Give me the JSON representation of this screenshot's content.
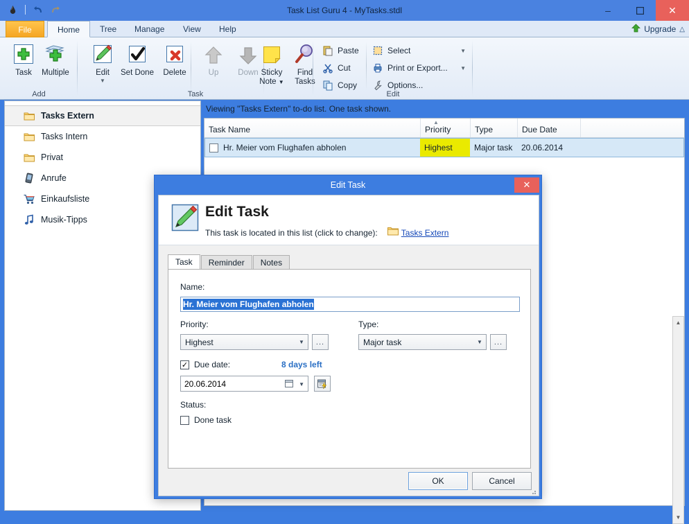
{
  "window": {
    "title": "Task List Guru 4 - MyTasks.stdl",
    "quick_access": [
      "app-icon",
      "undo-icon",
      "redo-icon"
    ],
    "buttons": {
      "minimize": "–",
      "maximize": "❐",
      "close": "✕"
    }
  },
  "ribbon": {
    "tabs": [
      {
        "label": "File",
        "active": false,
        "is_file": true
      },
      {
        "label": "Home",
        "active": true
      },
      {
        "label": "Tree",
        "active": false
      },
      {
        "label": "Manage",
        "active": false
      },
      {
        "label": "View",
        "active": false
      },
      {
        "label": "Help",
        "active": false
      }
    ],
    "upgrade_label": "Upgrade",
    "groups": [
      {
        "name": "Add",
        "buttons": [
          {
            "label": "Task",
            "icon": "add-task-icon",
            "enabled": true
          },
          {
            "label": "Multiple",
            "icon": "add-multiple-icon",
            "enabled": true
          }
        ]
      },
      {
        "name": "Task",
        "buttons": [
          {
            "label": "Edit",
            "icon": "edit-pencil-icon",
            "enabled": true,
            "has_dropdown": true
          },
          {
            "label": "Set Done",
            "icon": "checkmark-icon",
            "enabled": true
          },
          {
            "label": "Delete",
            "icon": "delete-x-icon",
            "enabled": true
          },
          {
            "label": "Up",
            "icon": "arrow-up-icon",
            "enabled": false
          },
          {
            "label": "Down",
            "icon": "arrow-down-icon",
            "enabled": false
          },
          {
            "label": "Sticky\nNote",
            "icon": "sticky-note-icon",
            "enabled": true,
            "has_dropdown": true
          },
          {
            "label": "Find\nTasks",
            "icon": "magnifier-icon",
            "enabled": true
          }
        ]
      },
      {
        "name": "Edit",
        "small_buttons": [
          {
            "label": "Paste",
            "icon": "paste-icon"
          },
          {
            "label": "Cut",
            "icon": "scissors-icon"
          },
          {
            "label": "Copy",
            "icon": "copy-icon"
          },
          {
            "label": "Select",
            "icon": "select-icon",
            "has_dropdown": true
          },
          {
            "label": "Print or Export...",
            "icon": "printer-icon",
            "has_dropdown": true
          },
          {
            "label": "Options...",
            "icon": "wrench-icon"
          }
        ]
      }
    ]
  },
  "sidebar": {
    "items": [
      {
        "label": "Tasks Extern",
        "icon": "folder-icon",
        "selected": true
      },
      {
        "label": "Tasks Intern",
        "icon": "folder-icon",
        "selected": false
      },
      {
        "label": "Privat",
        "icon": "folder-icon",
        "selected": false
      },
      {
        "label": "Anrufe",
        "icon": "phone-icon",
        "selected": false
      },
      {
        "label": "Einkaufsliste",
        "icon": "shopping-cart-icon",
        "selected": false
      },
      {
        "label": "Musik-Tipps",
        "icon": "music-note-icon",
        "selected": false
      }
    ]
  },
  "main": {
    "status_text": "Viewing \"Tasks Extern\" to-do list. One task shown.",
    "columns": [
      "Task Name",
      "Priority",
      "Type",
      "Due Date"
    ],
    "sorted_column": "Priority",
    "rows": [
      {
        "task_name": "Hr. Meier vom Flughafen abholen",
        "priority": "Highest",
        "type": "Major task",
        "due_date": "20.06.2014",
        "checked": false
      }
    ]
  },
  "dialog": {
    "titlebar": "Edit Task",
    "close_label": "✕",
    "heading": "Edit Task",
    "subtext": "This task is located in this list (click to change):",
    "list_link": "Tasks Extern",
    "tabs": [
      {
        "label": "Task",
        "active": true
      },
      {
        "label": "Reminder",
        "active": false
      },
      {
        "label": "Notes",
        "active": false
      }
    ],
    "fields": {
      "name_label": "Name:",
      "name_value": "Hr. Meier vom Flughafen abholen",
      "priority_label": "Priority:",
      "priority_value": "Highest",
      "priority_more": "...",
      "type_label": "Type:",
      "type_value": "Major task",
      "type_more": "...",
      "due_date_label": "Due date:",
      "due_date_checked": true,
      "due_date_value": "20.06.2014",
      "days_left": "8 days left",
      "status_label": "Status:",
      "done_label": "Done task",
      "done_checked": false
    },
    "buttons": {
      "ok": "OK",
      "cancel": "Cancel"
    }
  },
  "colors": {
    "window_frame": "#3d7de0",
    "titlebar": "#4a82e0",
    "close_red": "#e8615b",
    "file_tab": "#f5a623",
    "accent_link": "#1548b8",
    "priority_highlight": "#eaea00",
    "row_select": "#d6e8f7",
    "selection_blue": "#2a72d4",
    "days_left": "#2a6fc4"
  }
}
